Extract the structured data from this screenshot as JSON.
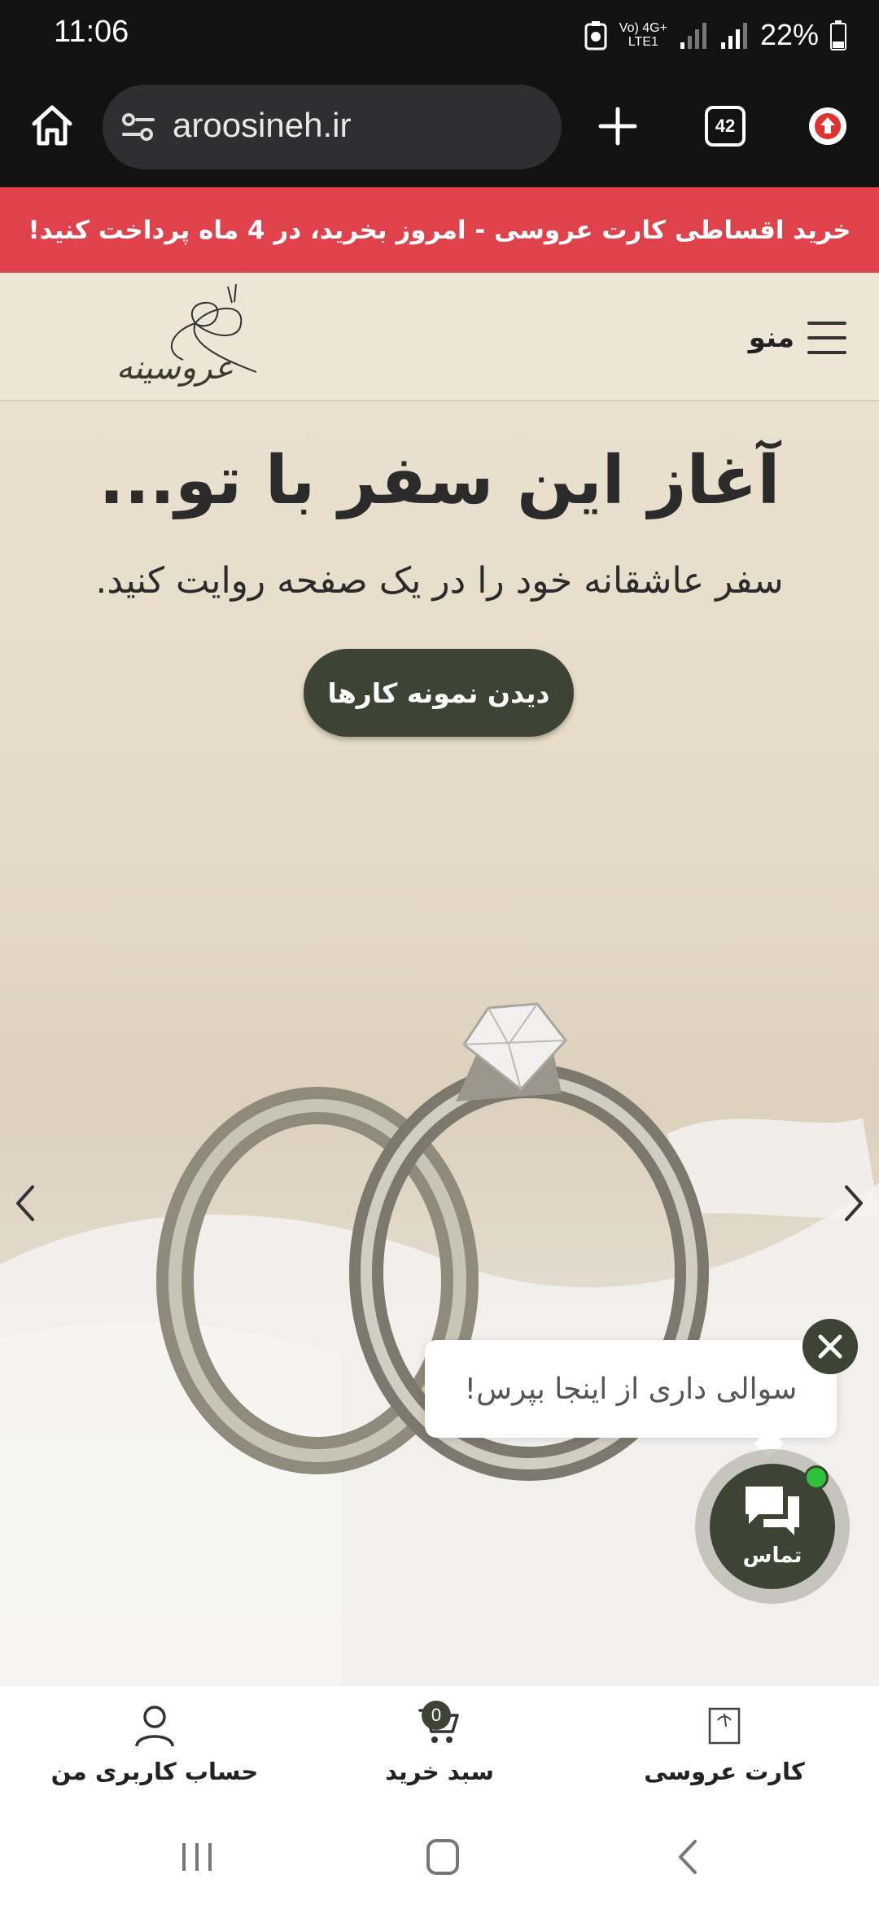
{
  "status_bar": {
    "time": "11:06",
    "network_top": "Vo) 4G+",
    "network_bottom": "LTE1",
    "battery": "22%"
  },
  "browser": {
    "url": "aroosineh.ir",
    "tab_count": "42"
  },
  "promo": {
    "text": "خرید اقساطی کارت عروسی - امروز بخرید، در 4 ماه پرداخت کنید!",
    "bg_color": "#e0424b"
  },
  "header": {
    "menu_label": "منو",
    "logo_text": "عروسینه"
  },
  "hero": {
    "title": "آغاز این سفر با تو...",
    "subtitle": "سفر عاشقانه خود را در یک صفحه روایت کنید.",
    "cta_label": "دیدن نمونه کارها",
    "accent_color": "#3e4433"
  },
  "chat": {
    "bubble_text": "سوالی داری از اینجا بپرس!",
    "fab_label": "تماس"
  },
  "bottom_nav": {
    "items": [
      {
        "label": "کارت عروسی",
        "icon": "wedding-card-icon"
      },
      {
        "label": "سبد خرید",
        "icon": "cart-icon",
        "badge": "0"
      },
      {
        "label": "حساب کاربری من",
        "icon": "user-icon"
      }
    ]
  }
}
